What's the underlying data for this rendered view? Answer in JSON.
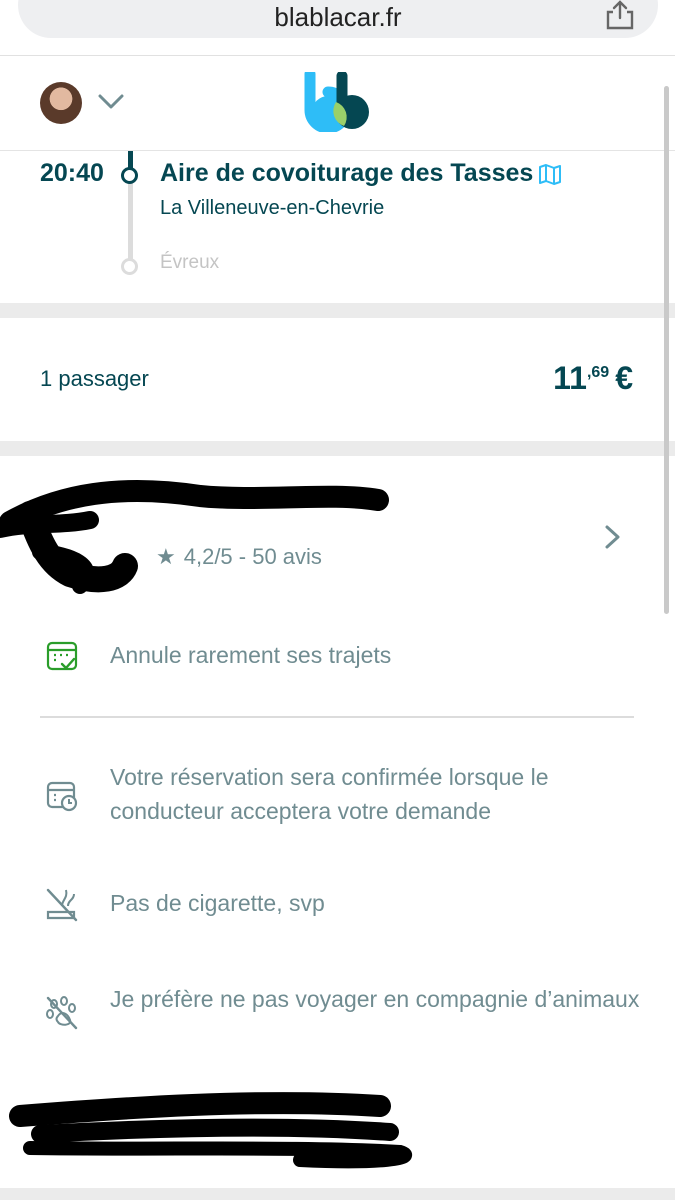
{
  "browser": {
    "url": "blablacar.fr"
  },
  "header": {
    "logo_alt": "BlaBlaCar"
  },
  "trip": {
    "departure_time": "20:40",
    "pickup_name": "Aire de covoiturage des Tasses",
    "pickup_city": "La Villeneuve-en-Chevrie",
    "destination_city": "Évreux"
  },
  "booking": {
    "passengers": "1 passager",
    "price_integer": "11",
    "price_decimal": ",69",
    "currency": "€"
  },
  "driver": {
    "rating": "4,2/5 - 50 avis"
  },
  "features": [
    {
      "icon": "calendar-check-icon",
      "text": "Annule rarement ses trajets",
      "color": "#2a9d2a"
    },
    {
      "icon": "calendar-clock-icon",
      "text": "Votre réservation sera confirmée lorsque le conducteur acceptera votre demande"
    },
    {
      "icon": "no-smoking-icon",
      "text": "Pas de cigarette, svp"
    },
    {
      "icon": "no-pets-icon",
      "text": "Je préfère ne pas voyager en compagnie d’animaux"
    }
  ],
  "colors": {
    "brand_dark": "#054752",
    "brand_light": "#2ebdf7",
    "muted": "#708c91"
  }
}
